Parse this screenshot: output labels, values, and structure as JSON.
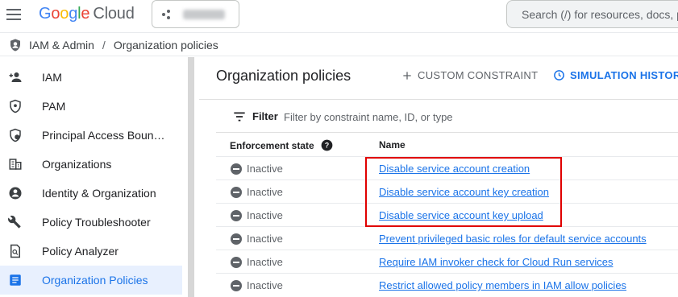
{
  "header": {
    "logo_google": "Google",
    "logo_cloud": "Cloud",
    "search_placeholder": "Search (/) for resources, docs, products, and more"
  },
  "breadcrumb": {
    "section": "IAM & Admin",
    "separator": "/",
    "page": "Organization policies"
  },
  "sidebar": {
    "items": [
      {
        "label": "IAM",
        "icon": "person-add-icon"
      },
      {
        "label": "PAM",
        "icon": "shield-key-icon"
      },
      {
        "label": "Principal Access Boun…",
        "icon": "shield-globe-icon"
      },
      {
        "label": "Organizations",
        "icon": "building-icon"
      },
      {
        "label": "Identity & Organization",
        "icon": "account-circle-icon"
      },
      {
        "label": "Policy Troubleshooter",
        "icon": "wrench-icon"
      },
      {
        "label": "Policy Analyzer",
        "icon": "document-search-icon"
      },
      {
        "label": "Organization Policies",
        "icon": "list-doc-icon",
        "active": true
      }
    ]
  },
  "main": {
    "title": "Organization policies",
    "custom_constraint": "CUSTOM CONSTRAINT",
    "simulation_history": "SIMULATION HISTORY",
    "filter_label": "Filter",
    "filter_placeholder": "Filter by constraint name, ID, or type",
    "columns": {
      "state": "Enforcement state",
      "name": "Name"
    },
    "rows": [
      {
        "state": "Inactive",
        "name": "Disable service account creation"
      },
      {
        "state": "Inactive",
        "name": "Disable service account key creation"
      },
      {
        "state": "Inactive",
        "name": "Disable service account key upload"
      },
      {
        "state": "Inactive",
        "name": "Prevent privileged basic roles for default service accounts"
      },
      {
        "state": "Inactive",
        "name": "Require IAM invoker check for Cloud Run services"
      },
      {
        "state": "Inactive",
        "name": "Restrict allowed policy members in IAM allow policies"
      }
    ]
  },
  "colors": {
    "accent": "#1a73e8",
    "highlight": "#e00000",
    "active_bg": "#e8f0fe"
  }
}
